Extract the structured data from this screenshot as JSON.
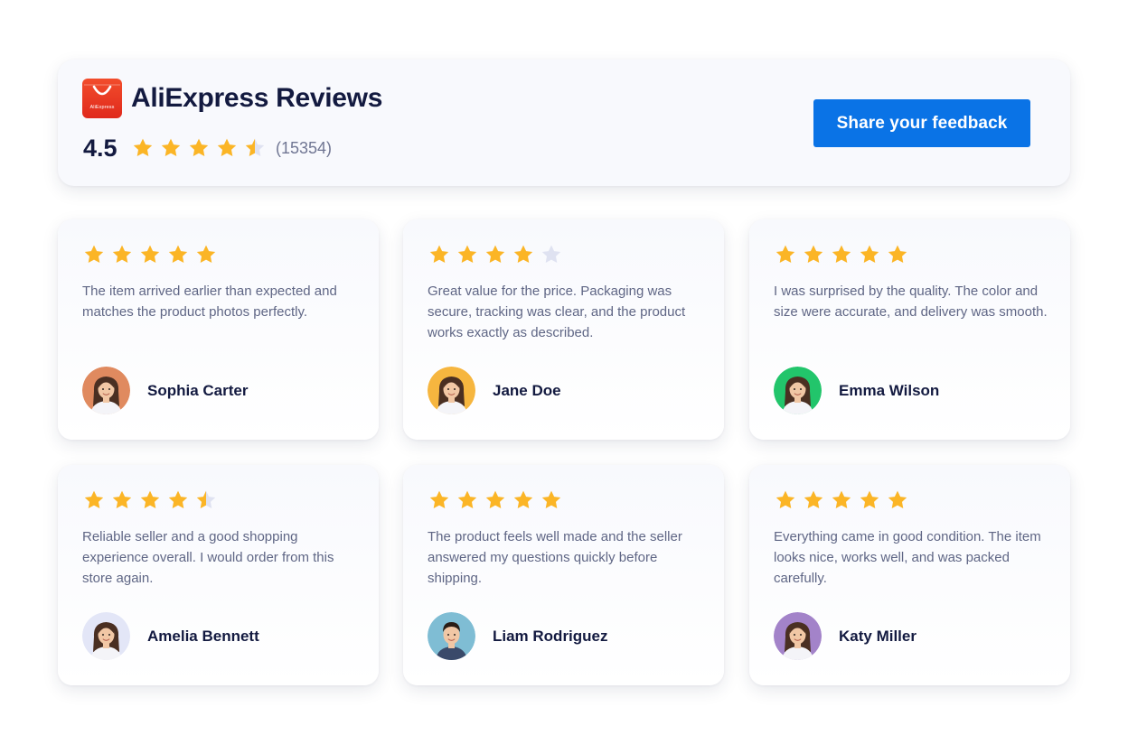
{
  "colors": {
    "star_filled": "#fbb526",
    "star_empty": "#dfe2f1",
    "button": "#0a73e6",
    "brand_red": "#e8321f",
    "heading": "#131a40",
    "body_text": "#5f6685"
  },
  "header": {
    "logo_icon": "aliexpress-bag-icon",
    "logo_text": "AliExpress",
    "title": "AliExpress Reviews",
    "rating_value": "4.5",
    "rating": 4.5,
    "review_count": "(15354)",
    "button_label": "Share your feedback"
  },
  "reviews": [
    {
      "rating": 5,
      "text": "The item arrived earlier than expected and matches the product photos perfectly.",
      "name": "Sophia Carter",
      "avatar_bg": "#e08a5f",
      "avatar_icon": "woman-avatar-icon"
    },
    {
      "rating": 4,
      "text": "Great value for the price. Packaging was secure, tracking was clear, and the product works exactly as described.",
      "name": "Jane Doe",
      "avatar_bg": "#f6b63f",
      "avatar_icon": "woman-avatar-icon"
    },
    {
      "rating": 5,
      "text": "I was surprised by the quality. The color and size were accurate, and delivery was smooth.",
      "name": "Emma Wilson",
      "avatar_bg": "#22c56b",
      "avatar_icon": "woman-avatar-icon"
    },
    {
      "rating": 4.5,
      "text": "Reliable seller and a good shopping experience overall. I would order from this store again.",
      "name": "Amelia Bennett",
      "avatar_bg": "#e3e6f7",
      "avatar_icon": "woman-avatar-icon"
    },
    {
      "rating": 5,
      "text": "The product feels well made and the seller answered my questions quickly before shipping.",
      "name": "Liam Rodriguez",
      "avatar_bg": "#7fbdd4",
      "avatar_icon": "man-avatar-icon"
    },
    {
      "rating": 5,
      "text": "Everything came in good condition. The item looks nice, works well, and was packed carefully.",
      "name": "Katy Miller",
      "avatar_bg": "#a383c9",
      "avatar_icon": "woman-avatar-icon"
    }
  ]
}
